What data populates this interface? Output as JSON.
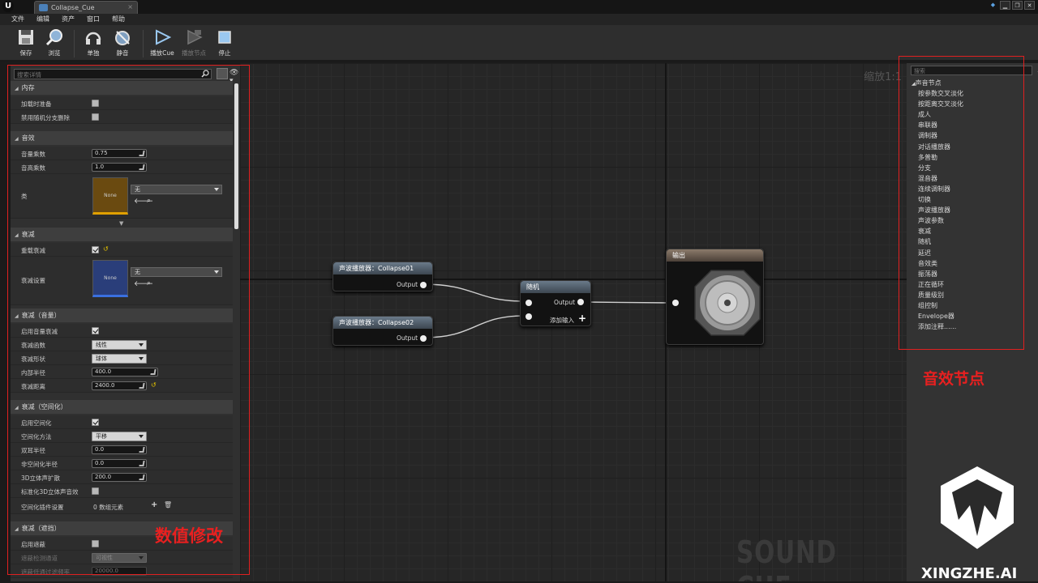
{
  "window": {
    "tab_title": "Collapse_Cue",
    "tab_close": "×"
  },
  "menu": [
    "文件",
    "编辑",
    "资产",
    "窗口",
    "帮助"
  ],
  "toolbar": {
    "save": "保存",
    "browse": "浏览",
    "solo": "单独",
    "mute": "静音",
    "play_cue": "播放Cue",
    "play_node": "播放节点",
    "stop": "停止"
  },
  "details": {
    "search_placeholder": "搜索详情",
    "sections": {
      "memory": "内存",
      "sound": "音效",
      "attenuation": "衰减",
      "att_volume": "衰减（音量）",
      "att_spatial": "衰减（空间化）",
      "att_occlusion": "衰减（遮挡）"
    },
    "rows": {
      "load_on_ready": "加载时准备",
      "disable_random_branch": "禁用随机分支删除",
      "volume_multiplier": "音量乘数",
      "volume_value": "0.75",
      "pitch_multiplier": "音高乘数",
      "pitch_value": "1.0",
      "sound_class": "类",
      "sound_class_thumb": "None",
      "sound_class_value": "无",
      "override_attenuation": "重载衰减",
      "attenuation_settings": "衰减设置",
      "attenuation_thumb": "None",
      "attenuation_value": "无",
      "enable_volume_att": "启用音量衰减",
      "att_function": "衰减函数",
      "att_function_value": "线性",
      "att_shape": "衰减形状",
      "att_shape_value": "球体",
      "inner_radius": "内部半径",
      "inner_radius_value": "400.0",
      "falloff_distance": "衰减距离",
      "falloff_distance_value": "2400.0",
      "enable_spatial": "启用空间化",
      "spatial_method": "空间化方法",
      "spatial_method_value": "平移",
      "binaural_radius": "双耳半径",
      "binaural_radius_value": "0.0",
      "nonspatial_radius": "非空间化半径",
      "nonspatial_radius_value": "0.0",
      "stereo_spread": "3D立体声扩散",
      "stereo_spread_value": "200.0",
      "normalize_3d": "标准化3D立体声音效",
      "spatial_plugin": "空间化插件设置",
      "spatial_plugin_value": "0 数组元素",
      "enable_occlusion": "启用遮蔽",
      "occlusion_channel": "遮蔽检测通道",
      "occlusion_channel_value": "可视性",
      "occlusion_lowpass": "遮蔽低通过滤频率",
      "occlusion_lowpass_value": "20000.0"
    }
  },
  "graph": {
    "zoom": "缩放1:1",
    "watermark": "SOUND CUE",
    "nodes": {
      "wave1_title": "声波播放器：Collapse01",
      "wave2_title": "声波播放器：Collapse02",
      "random_title": "随机",
      "output_title": "输出",
      "output_pin": "Output",
      "add_input": "添加输入"
    }
  },
  "palette": {
    "search_placeholder": "搜索",
    "header": "声音节点",
    "items": [
      "按参数交叉淡化",
      "按距离交叉淡化",
      "成人",
      "串联器",
      "调制器",
      "对话播放器",
      "多普勒",
      "分支",
      "混音器",
      "连续调制器",
      "切换",
      "声波播放器",
      "声波参数",
      "衰减",
      "随机",
      "延迟",
      "音效类",
      "振荡器",
      "正在循环",
      "质量级别",
      "组控制",
      "Envelope器",
      "添加注释......"
    ]
  },
  "annotations": {
    "left_label": "数值修改",
    "right_label": "音效节点",
    "brand": "XINGZHE.AI",
    "color": "#e02020"
  }
}
